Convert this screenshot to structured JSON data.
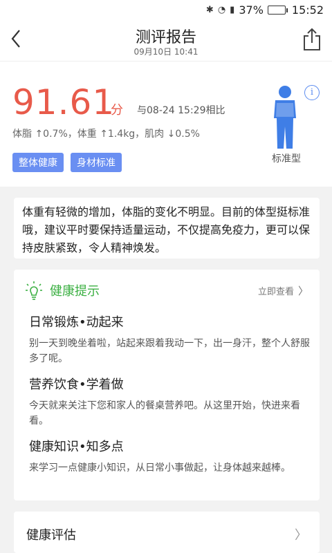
{
  "status_bar": {
    "battery_percent": "37%",
    "time": "15:52",
    "battery_level": 0.37,
    "icons": [
      "bluetooth-icon",
      "wifi-icon",
      "signal-icon",
      "battery-icon"
    ]
  },
  "header": {
    "title": "测评报告",
    "subtitle": "09月10日 10:41",
    "icons": [
      "back-arrow-icon",
      "share-icon"
    ]
  },
  "score": {
    "value": "91.61",
    "unit": "分",
    "compare": "与08-24 15:29相比",
    "deltas": "体脂 ↑0.7%，体重 ↑1.4kg，肌肉 ↓0.5%",
    "tags": [
      "整体健康",
      "身材标准"
    ],
    "body_type": "标准型",
    "accent_color": "#e85a4a",
    "tag_color": "#6a8ff2"
  },
  "summary": {
    "text": "体重有轻微的增加，体脂的变化不明显。目前的体型挺标准哦，建议平时要保持适量运动，不仅提高免疫力，更可以保持皮肤紧致，令人精神焕发。"
  },
  "tips": {
    "title": "健康提示",
    "more": "立即查看",
    "title_color": "#3cb043",
    "items": [
      {
        "title": "日常锻炼•动起来",
        "desc": "别一天到晚坐着啦，站起来跟着我动一下，出一身汗，整个人舒服多了呢。"
      },
      {
        "title": "营养饮食•学着做",
        "desc": "今天就来关注下您和家人的餐桌营养吧。从这里开始，快进来看看。"
      },
      {
        "title": "健康知识•知多点",
        "desc": "来学习一点健康小知识，从日常小事做起，让身体越来越棒。"
      }
    ]
  },
  "evaluation": {
    "label": "健康评估"
  }
}
